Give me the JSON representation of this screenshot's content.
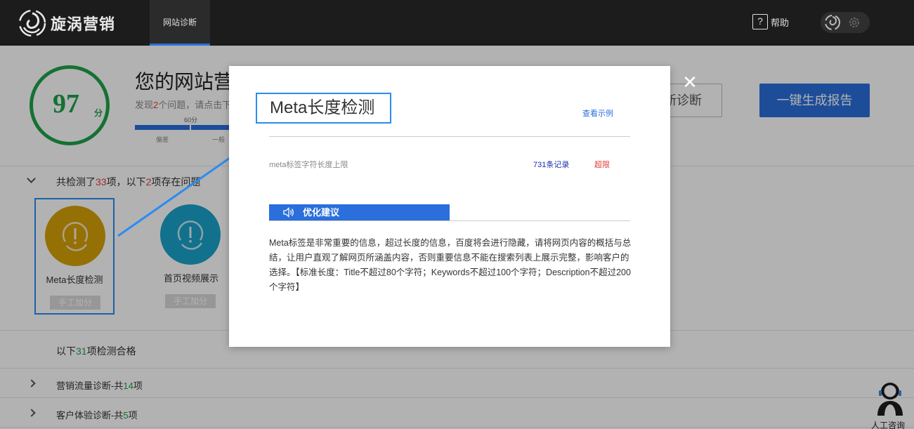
{
  "app": {
    "logo_text": "旋涡营销"
  },
  "nav": {
    "tab": "网站诊断"
  },
  "header": {
    "help_label": "帮助",
    "help_icon_glyph": "?"
  },
  "score": {
    "value": "97",
    "unit": "分",
    "color": "#1fa24a"
  },
  "band": {
    "title": "您的网站营",
    "sub_prefix": "发现",
    "sub_count": "2",
    "sub_suffix": "个问题，请点击下",
    "scale_mark": "60分",
    "scale_low": "偏差",
    "scale_mid": "一般",
    "rediagnose_label": "新诊断",
    "report_label": "一键生成报告"
  },
  "problems": {
    "prefix": "共检测了",
    "total": "33",
    "middle": "项，以下",
    "count": "2",
    "suffix": "项存在问题",
    "items": [
      {
        "label": "Meta长度检测",
        "action": "手工加分",
        "color": "#d6a106",
        "icon": "alert-icon"
      },
      {
        "label": "首页视频展示",
        "action": "手工加分",
        "color": "#1aa3c9",
        "icon": "alert-icon"
      }
    ]
  },
  "passed": {
    "prefix": "以下",
    "count": "31",
    "suffix": "项检测合格"
  },
  "categories": [
    {
      "prefix": "营销流量诊断-共",
      "count": "14",
      "suffix": "项"
    },
    {
      "prefix": "客户体验诊断-共",
      "count": "5",
      "suffix": "项"
    }
  ],
  "support": {
    "label": "人工咨询"
  },
  "modal": {
    "title": "Meta长度检测",
    "example_link": "查看示例",
    "record_label": "meta标签字符长度上限",
    "record_count": "731条记录",
    "record_status": "超限",
    "advice_tab": "优化建议",
    "advice_text": "Meta标签是非常重要的信息，超过长度的信息，百度将会进行隐藏，请将网页内容的概括与总结，让用户直观了解网页所涵盖内容，否则重要信息不能在搜索列表上展示完整，影响客户的选择。【标准长度：Title不超过80个字符；Keywords不超过100个字符；Description不超过200个字符】",
    "close_glyph": "✕"
  }
}
